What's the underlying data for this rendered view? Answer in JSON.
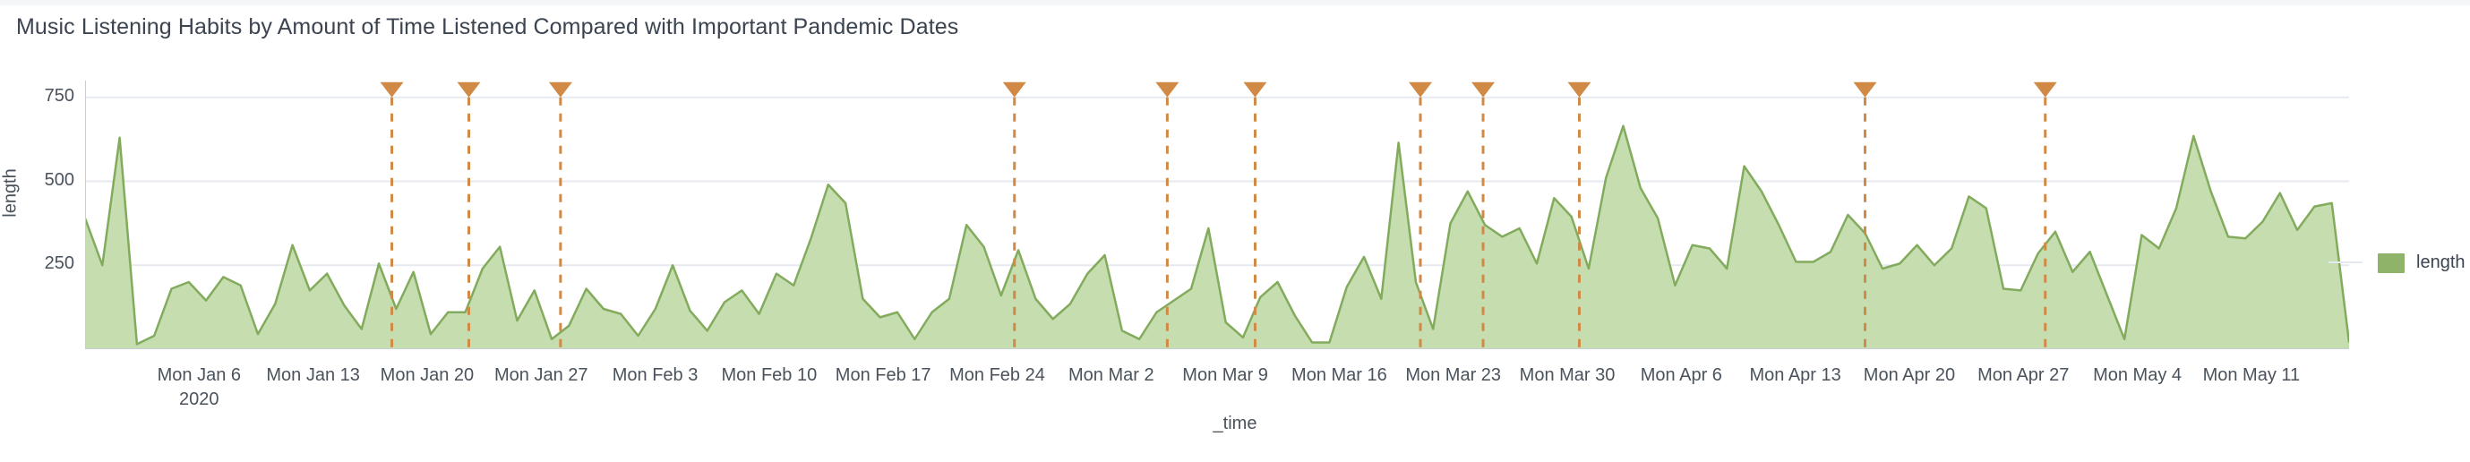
{
  "header": {
    "title": "Music Listening Habits by Amount of Time Listened Compared with Important Pandemic Dates"
  },
  "legend": {
    "label": "length",
    "swatch_color": "#8fb469",
    "position": "right"
  },
  "axes": {
    "y_label": "length",
    "x_label": "_time",
    "y_ticks": [
      "250",
      "500",
      "750"
    ],
    "x_tick_sub": "2020"
  },
  "colors": {
    "area_fill": "#c6ddb0",
    "area_stroke": "#83ab5d",
    "marker_line": "#d08a46",
    "gridline": "#e6eaf0",
    "axis": "#c9ced6",
    "text": "#4a525c",
    "title": "#3b4450"
  },
  "chart_data": {
    "type": "area",
    "title": "Music Listening Habits by Amount of Time Listened Compared with Important Pandemic Dates",
    "xlabel": "_time",
    "ylabel": "length",
    "ylim": [
      0,
      800
    ],
    "y_ticks": [
      250,
      500,
      750
    ],
    "grid": true,
    "legend_position": "right",
    "x_type": "date",
    "x_range": [
      "2019-12-30",
      "2020-05-17"
    ],
    "x_tick_labels": [
      "Mon Jan 6",
      "Mon Jan 13",
      "Mon Jan 20",
      "Mon Jan 27",
      "Mon Feb 3",
      "Mon Feb 10",
      "Mon Feb 17",
      "Mon Feb 24",
      "Mon Mar 2",
      "Mon Mar 9",
      "Mon Mar 16",
      "Mon Mar 23",
      "Mon Mar 30",
      "Mon Apr 6",
      "Mon Apr 13",
      "Mon Apr 20",
      "Mon Apr 27",
      "Mon May 4",
      "Mon May 11"
    ],
    "x_tick_dates": [
      "2020-01-06",
      "2020-01-13",
      "2020-01-20",
      "2020-01-27",
      "2020-02-03",
      "2020-02-10",
      "2020-02-17",
      "2020-02-24",
      "2020-03-02",
      "2020-03-09",
      "2020-03-16",
      "2020-03-23",
      "2020-03-30",
      "2020-04-06",
      "2020-04-13",
      "2020-04-20",
      "2020-04-27",
      "2020-05-04",
      "2020-05-11"
    ],
    "series": [
      {
        "name": "length",
        "type": "area",
        "fill": "#c6ddb0",
        "stroke": "#83ab5d",
        "values": [
          390,
          250,
          630,
          15,
          40,
          180,
          200,
          145,
          215,
          190,
          45,
          135,
          310,
          175,
          225,
          130,
          60,
          255,
          120,
          230,
          45,
          110,
          110,
          240,
          305,
          85,
          175,
          30,
          70,
          180,
          120,
          105,
          40,
          120,
          250,
          115,
          55,
          140,
          175,
          105,
          225,
          190,
          330,
          490,
          435,
          150,
          95,
          110,
          30,
          110,
          150,
          370,
          305,
          160,
          295,
          150,
          90,
          135,
          225,
          280,
          55,
          30,
          110,
          145,
          180,
          360,
          80,
          35,
          155,
          200,
          100,
          20,
          20,
          185,
          275,
          150,
          615,
          200,
          60,
          375,
          470,
          370,
          335,
          360,
          255,
          450,
          395,
          240,
          510,
          665,
          480,
          390,
          190,
          310,
          300,
          240,
          545,
          470,
          370,
          260,
          260,
          290,
          400,
          345,
          240,
          255,
          310,
          250,
          300,
          455,
          420,
          180,
          175,
          285,
          350,
          230,
          290,
          160,
          30,
          340,
          300,
          420,
          635,
          470,
          335,
          330,
          380,
          465,
          355,
          425,
          435,
          20
        ]
      }
    ],
    "markers": {
      "name": "Important Pandemic Dates",
      "color": "#d08a46",
      "style": "dashed vertical line with downward triangle at top (y=750)",
      "triangle_y_value": 750,
      "x_fractions": [
        0.1355,
        0.1695,
        0.21,
        0.4105,
        0.478,
        0.5168,
        0.5898,
        0.6175,
        0.66,
        0.7862,
        0.8658
      ]
    }
  }
}
